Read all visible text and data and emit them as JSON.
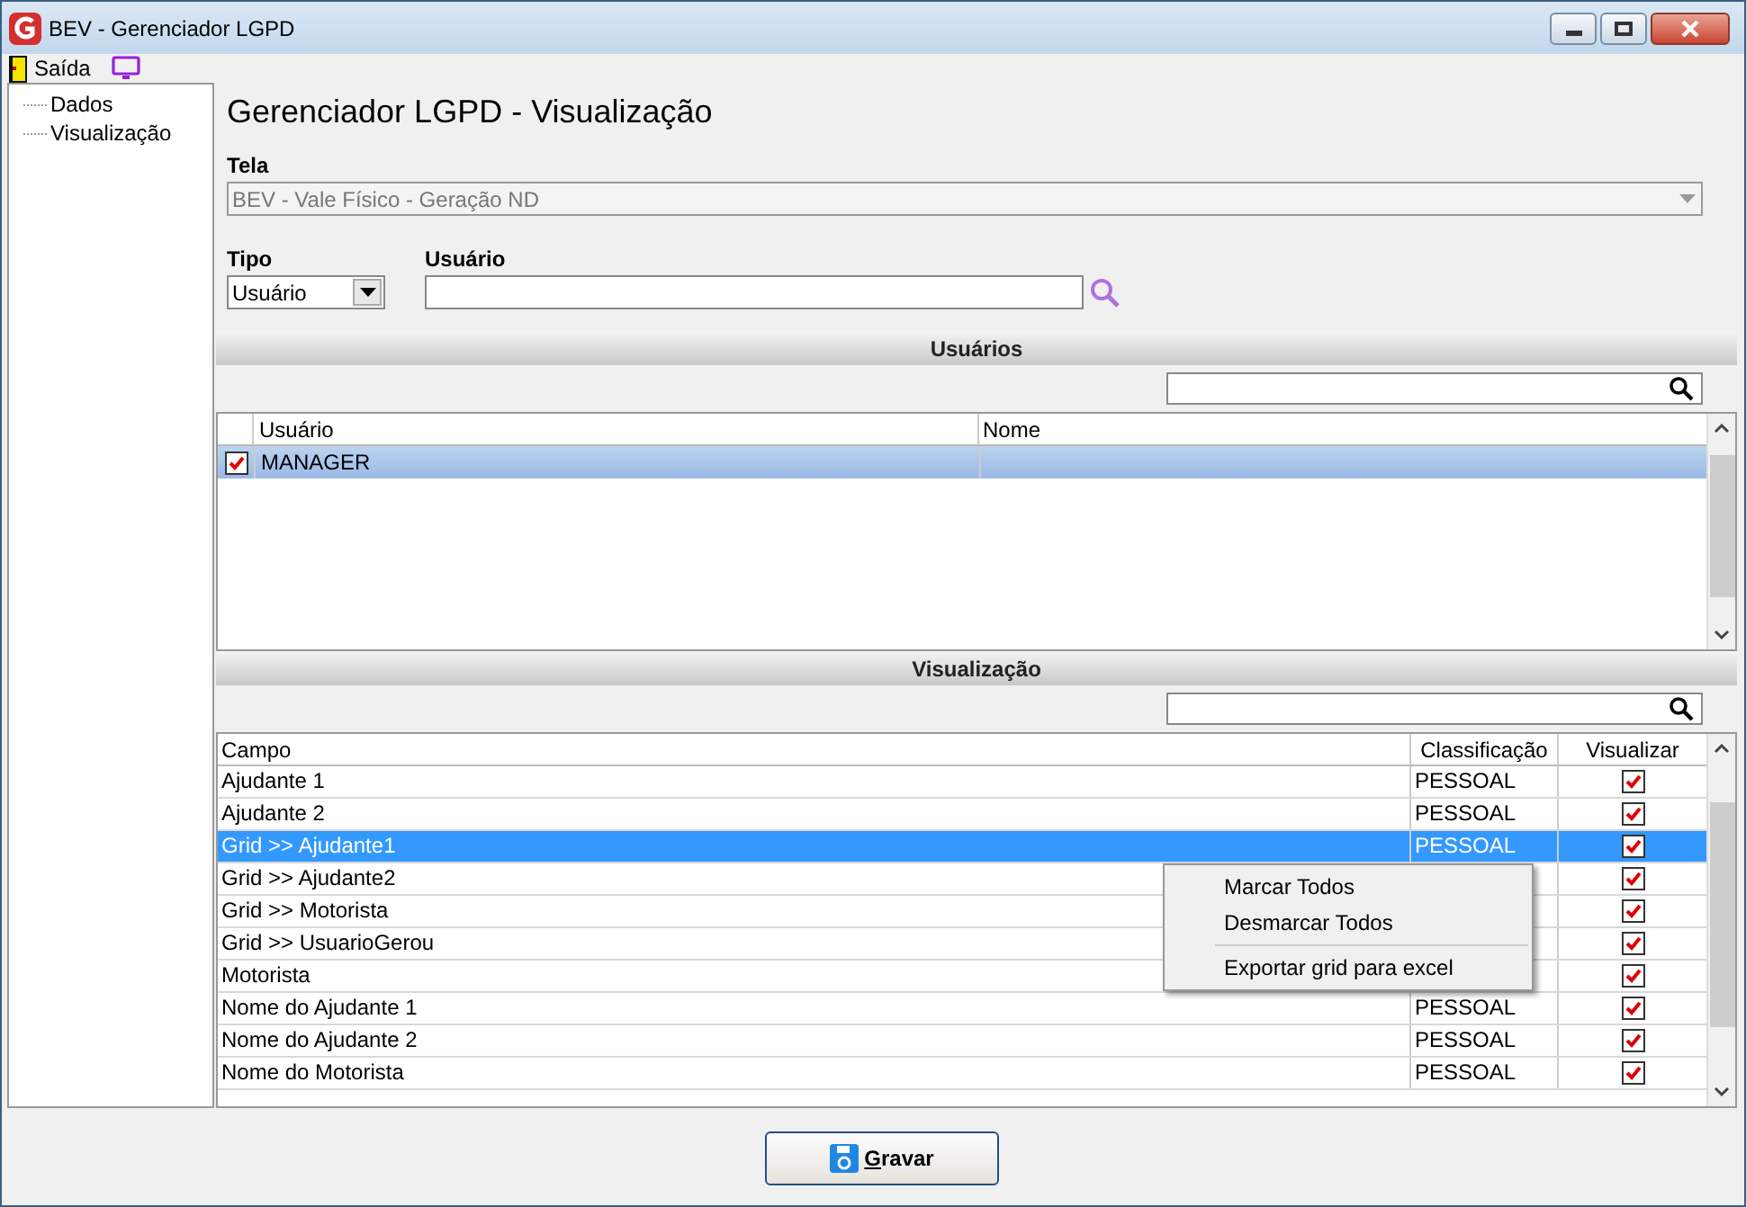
{
  "window": {
    "title": "BEV - Gerenciador LGPD"
  },
  "menu": {
    "exit_label": "Saída"
  },
  "tree": [
    {
      "label": "Dados"
    },
    {
      "label": "Visualização"
    }
  ],
  "heading": "Gerenciador LGPD - Visualização",
  "tela": {
    "label": "Tela",
    "value": "BEV - Vale Físico - Geração ND",
    "disabled": true
  },
  "tipo": {
    "label": "Tipo",
    "value": "Usuário"
  },
  "usuario": {
    "label": "Usuário"
  },
  "users_section": {
    "title": "Usuários",
    "columns": [
      "Usuário",
      "Nome"
    ],
    "rows": [
      {
        "usuario": "MANAGER",
        "checked": true,
        "selected": true
      }
    ]
  },
  "view_section": {
    "title": "Visualização",
    "columns": [
      "Campo",
      "Classificação",
      "Visualizar"
    ],
    "rows": [
      {
        "campo": "Ajudante 1",
        "classificacao": "PESSOAL",
        "visualizar": true,
        "selected": false
      },
      {
        "campo": "Ajudante 2",
        "classificacao": "PESSOAL",
        "visualizar": true,
        "selected": false
      },
      {
        "campo": "Grid >> Ajudante1",
        "classificacao": "PESSOAL",
        "visualizar": true,
        "selected": true
      },
      {
        "campo": "Grid >> Ajudante2",
        "visualizar": true,
        "selected": false
      },
      {
        "campo": "Grid >> Motorista",
        "visualizar": true,
        "selected": false
      },
      {
        "campo": "Grid >> UsuarioGerou",
        "visualizar": true,
        "selected": false
      },
      {
        "campo": "Motorista",
        "visualizar": true,
        "selected": false
      },
      {
        "campo": "Nome do Ajudante 1",
        "classificacao": "PESSOAL",
        "visualizar": true,
        "selected": false
      },
      {
        "campo": "Nome do Ajudante 2",
        "classificacao": "PESSOAL",
        "visualizar": true,
        "selected": false
      },
      {
        "campo": "Nome do Motorista",
        "classificacao": "PESSOAL",
        "visualizar": true,
        "selected": false
      }
    ]
  },
  "context_menu": [
    {
      "kind": "item",
      "label": "Marcar Todos"
    },
    {
      "kind": "item",
      "label": "Desmarcar Todos"
    },
    {
      "kind": "separator"
    },
    {
      "kind": "item",
      "label": "Exportar grid para excel"
    }
  ],
  "save_button": "Gravar"
}
